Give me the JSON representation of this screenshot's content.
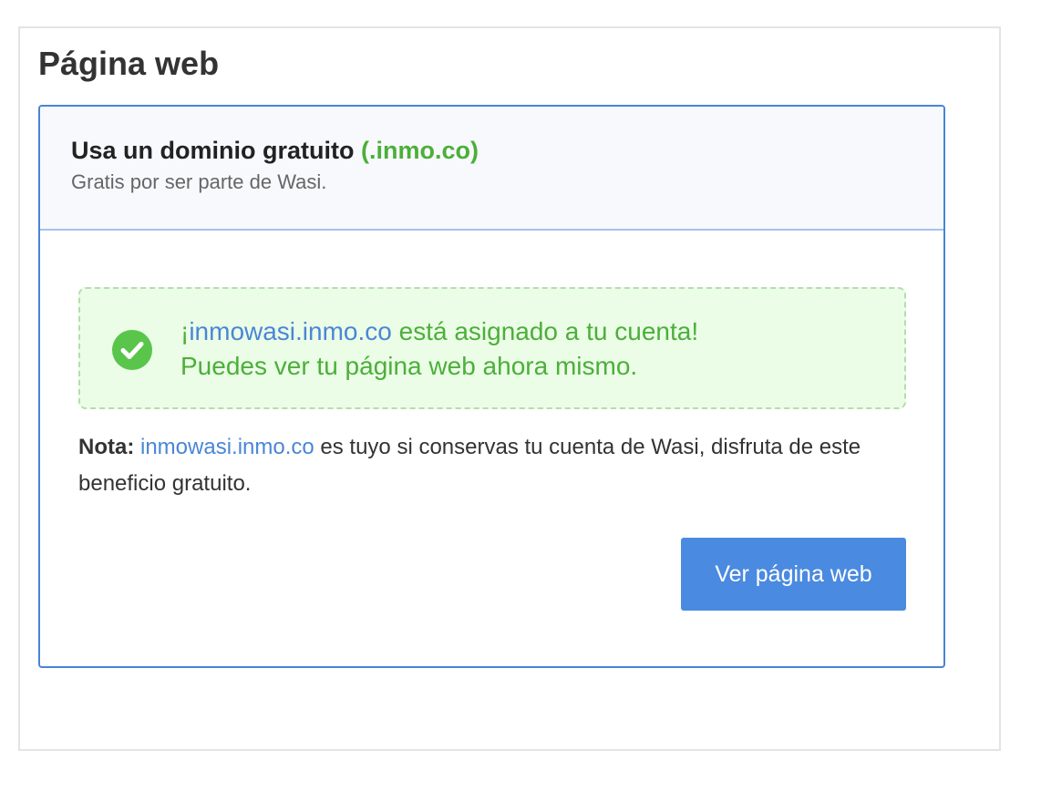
{
  "page": {
    "title": "Página web"
  },
  "card": {
    "header": {
      "title": "Usa un dominio gratuito",
      "title_accent": "(.inmo.co)",
      "subtitle": "Gratis por ser parte de Wasi."
    },
    "success": {
      "prefix": "¡",
      "domain": "inmowasi.inmo.co",
      "line1_suffix": " está asignado a tu cuenta!",
      "line2": "Puedes ver tu página web ahora mismo.",
      "icon": "check-circle-icon"
    },
    "note": {
      "label": "Nota:",
      "domain": "inmowasi.inmo.co",
      "text": " es tuyo si conservas tu cuenta de Wasi, disfruta de este beneficio gratuito."
    },
    "button": {
      "label": "Ver página web"
    }
  },
  "colors": {
    "brand_blue": "#4a8ae0",
    "success_green": "#4caf3a",
    "success_bg": "#ebfde7",
    "link_blue": "#4a86d6",
    "card_border": "#4a84d4"
  }
}
